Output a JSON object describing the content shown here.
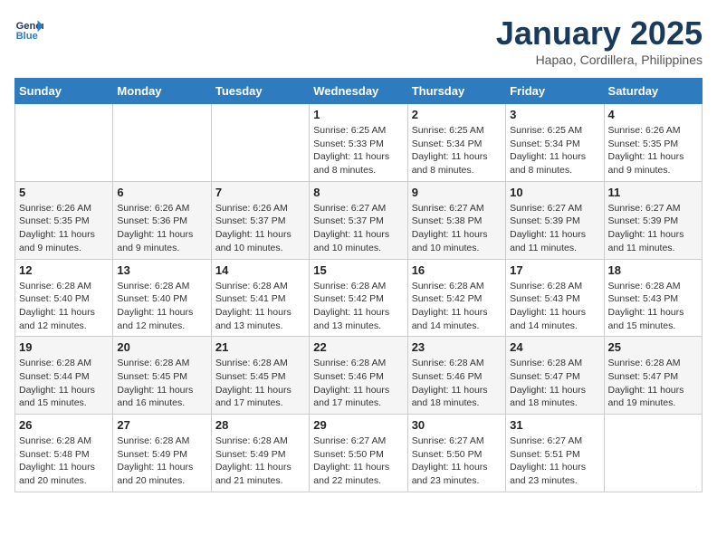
{
  "header": {
    "logo_line1": "General",
    "logo_line2": "Blue",
    "month_title": "January 2025",
    "subtitle": "Hapao, Cordillera, Philippines"
  },
  "weekdays": [
    "Sunday",
    "Monday",
    "Tuesday",
    "Wednesday",
    "Thursday",
    "Friday",
    "Saturday"
  ],
  "weeks": [
    [
      {
        "day": "",
        "info": ""
      },
      {
        "day": "",
        "info": ""
      },
      {
        "day": "",
        "info": ""
      },
      {
        "day": "1",
        "info": "Sunrise: 6:25 AM\nSunset: 5:33 PM\nDaylight: 11 hours and 8 minutes."
      },
      {
        "day": "2",
        "info": "Sunrise: 6:25 AM\nSunset: 5:34 PM\nDaylight: 11 hours and 8 minutes."
      },
      {
        "day": "3",
        "info": "Sunrise: 6:25 AM\nSunset: 5:34 PM\nDaylight: 11 hours and 8 minutes."
      },
      {
        "day": "4",
        "info": "Sunrise: 6:26 AM\nSunset: 5:35 PM\nDaylight: 11 hours and 9 minutes."
      }
    ],
    [
      {
        "day": "5",
        "info": "Sunrise: 6:26 AM\nSunset: 5:35 PM\nDaylight: 11 hours and 9 minutes."
      },
      {
        "day": "6",
        "info": "Sunrise: 6:26 AM\nSunset: 5:36 PM\nDaylight: 11 hours and 9 minutes."
      },
      {
        "day": "7",
        "info": "Sunrise: 6:26 AM\nSunset: 5:37 PM\nDaylight: 11 hours and 10 minutes."
      },
      {
        "day": "8",
        "info": "Sunrise: 6:27 AM\nSunset: 5:37 PM\nDaylight: 11 hours and 10 minutes."
      },
      {
        "day": "9",
        "info": "Sunrise: 6:27 AM\nSunset: 5:38 PM\nDaylight: 11 hours and 10 minutes."
      },
      {
        "day": "10",
        "info": "Sunrise: 6:27 AM\nSunset: 5:39 PM\nDaylight: 11 hours and 11 minutes."
      },
      {
        "day": "11",
        "info": "Sunrise: 6:27 AM\nSunset: 5:39 PM\nDaylight: 11 hours and 11 minutes."
      }
    ],
    [
      {
        "day": "12",
        "info": "Sunrise: 6:28 AM\nSunset: 5:40 PM\nDaylight: 11 hours and 12 minutes."
      },
      {
        "day": "13",
        "info": "Sunrise: 6:28 AM\nSunset: 5:40 PM\nDaylight: 11 hours and 12 minutes."
      },
      {
        "day": "14",
        "info": "Sunrise: 6:28 AM\nSunset: 5:41 PM\nDaylight: 11 hours and 13 minutes."
      },
      {
        "day": "15",
        "info": "Sunrise: 6:28 AM\nSunset: 5:42 PM\nDaylight: 11 hours and 13 minutes."
      },
      {
        "day": "16",
        "info": "Sunrise: 6:28 AM\nSunset: 5:42 PM\nDaylight: 11 hours and 14 minutes."
      },
      {
        "day": "17",
        "info": "Sunrise: 6:28 AM\nSunset: 5:43 PM\nDaylight: 11 hours and 14 minutes."
      },
      {
        "day": "18",
        "info": "Sunrise: 6:28 AM\nSunset: 5:43 PM\nDaylight: 11 hours and 15 minutes."
      }
    ],
    [
      {
        "day": "19",
        "info": "Sunrise: 6:28 AM\nSunset: 5:44 PM\nDaylight: 11 hours and 15 minutes."
      },
      {
        "day": "20",
        "info": "Sunrise: 6:28 AM\nSunset: 5:45 PM\nDaylight: 11 hours and 16 minutes."
      },
      {
        "day": "21",
        "info": "Sunrise: 6:28 AM\nSunset: 5:45 PM\nDaylight: 11 hours and 17 minutes."
      },
      {
        "day": "22",
        "info": "Sunrise: 6:28 AM\nSunset: 5:46 PM\nDaylight: 11 hours and 17 minutes."
      },
      {
        "day": "23",
        "info": "Sunrise: 6:28 AM\nSunset: 5:46 PM\nDaylight: 11 hours and 18 minutes."
      },
      {
        "day": "24",
        "info": "Sunrise: 6:28 AM\nSunset: 5:47 PM\nDaylight: 11 hours and 18 minutes."
      },
      {
        "day": "25",
        "info": "Sunrise: 6:28 AM\nSunset: 5:47 PM\nDaylight: 11 hours and 19 minutes."
      }
    ],
    [
      {
        "day": "26",
        "info": "Sunrise: 6:28 AM\nSunset: 5:48 PM\nDaylight: 11 hours and 20 minutes."
      },
      {
        "day": "27",
        "info": "Sunrise: 6:28 AM\nSunset: 5:49 PM\nDaylight: 11 hours and 20 minutes."
      },
      {
        "day": "28",
        "info": "Sunrise: 6:28 AM\nSunset: 5:49 PM\nDaylight: 11 hours and 21 minutes."
      },
      {
        "day": "29",
        "info": "Sunrise: 6:27 AM\nSunset: 5:50 PM\nDaylight: 11 hours and 22 minutes."
      },
      {
        "day": "30",
        "info": "Sunrise: 6:27 AM\nSunset: 5:50 PM\nDaylight: 11 hours and 23 minutes."
      },
      {
        "day": "31",
        "info": "Sunrise: 6:27 AM\nSunset: 5:51 PM\nDaylight: 11 hours and 23 minutes."
      },
      {
        "day": "",
        "info": ""
      }
    ]
  ]
}
